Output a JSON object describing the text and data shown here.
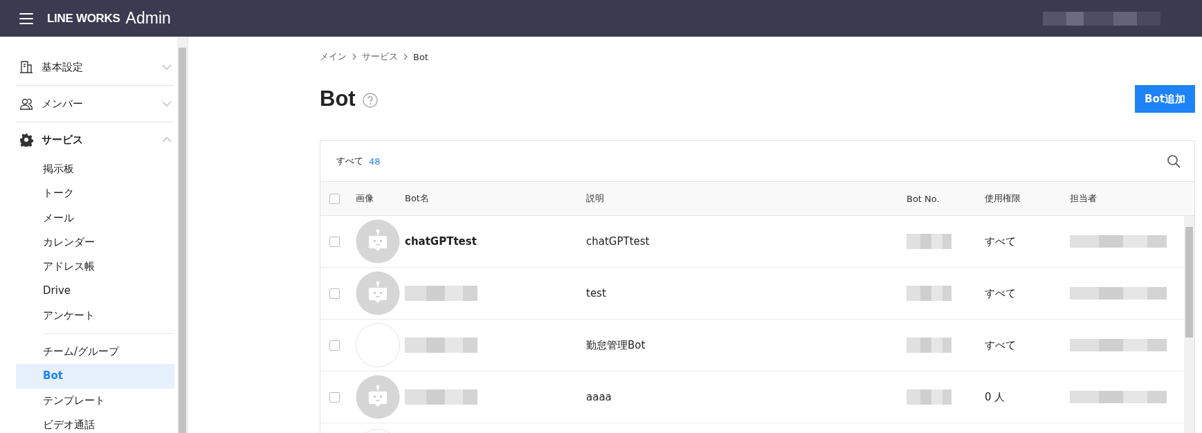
{
  "header": {
    "brand": "LINE WORKS",
    "product": "Admin"
  },
  "sidebar": {
    "sections": [
      {
        "label": "基本設定",
        "expanded": false
      },
      {
        "label": "メンバー",
        "expanded": false
      },
      {
        "label": "サービス",
        "expanded": true,
        "items": [
          {
            "label": "掲示板",
            "selected": false
          },
          {
            "label": "トーク",
            "selected": false
          },
          {
            "label": "メール",
            "selected": false
          },
          {
            "label": "カレンダー",
            "selected": false
          },
          {
            "label": "アドレス帳",
            "selected": false
          },
          {
            "label": "Drive",
            "selected": false
          },
          {
            "label": "アンケート",
            "selected": false
          },
          {
            "kind": "divider"
          },
          {
            "label": "チーム/グループ",
            "selected": false
          },
          {
            "label": "Bot",
            "selected": true
          },
          {
            "label": "テンプレート",
            "selected": false
          },
          {
            "label": "ビデオ通話",
            "selected": false
          }
        ]
      }
    ]
  },
  "breadcrumb": [
    "メイン",
    "サービス",
    "Bot"
  ],
  "page_title": "Bot",
  "add_button": "Bot追加",
  "filter": {
    "label": "すべて",
    "count": "48"
  },
  "table": {
    "select_all_checked": false,
    "columns": [
      "画像",
      "Bot名",
      "説明",
      "Bot No.",
      "使用権限",
      "担当者"
    ],
    "rows": [
      {
        "checked": false,
        "kind": "bot",
        "name": "chatGPTtest",
        "description": "chatGPTtest",
        "permission": "すべて"
      },
      {
        "checked": false,
        "kind": "bot",
        "name": null,
        "description": "test",
        "permission": "すべて"
      },
      {
        "checked": false,
        "kind": "blank",
        "name": null,
        "description": "勤怠管理Bot",
        "permission": "すべて"
      },
      {
        "checked": false,
        "kind": "bot",
        "name": null,
        "description": "aaaa",
        "permission": "0 人"
      }
    ]
  }
}
